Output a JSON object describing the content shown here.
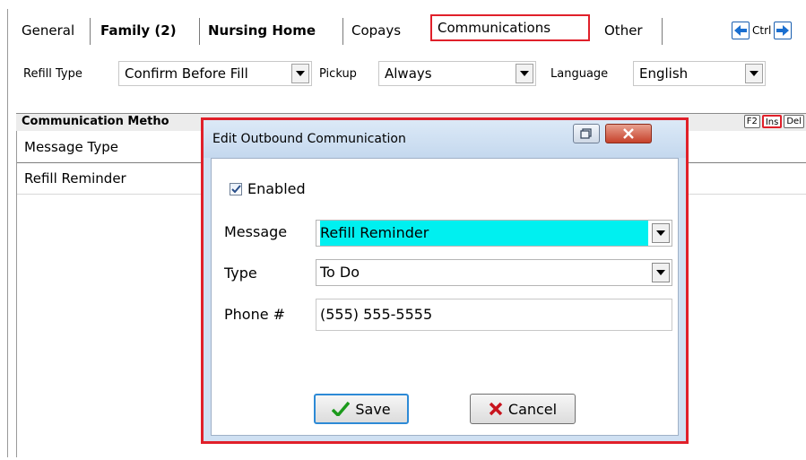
{
  "tabs": {
    "general": "General",
    "family": "Family (2)",
    "nursing_home": "Nursing Home",
    "copays": "Copays",
    "communications": "Communications",
    "other": "Other",
    "ctrl_label": "Ctrl"
  },
  "settings": {
    "refill_type_label": "Refill Type",
    "refill_type_value": "Confirm Before Fill",
    "pickup_label": "Pickup",
    "pickup_value": "Always",
    "language_label": "Language",
    "language_value": "English"
  },
  "comm_panel": {
    "title": "Communication Metho",
    "keys": [
      "F2",
      "Ins",
      "Del"
    ],
    "column_header": "Message Type",
    "rows": [
      "Refill Reminder"
    ]
  },
  "dialog": {
    "title": "Edit Outbound Communication",
    "enabled_label": "Enabled",
    "enabled_checked": true,
    "message_label": "Message",
    "message_value": "Refill Reminder",
    "type_label": "Type",
    "type_value": "To Do",
    "phone_label": "Phone #",
    "phone_value": "(555) 555-5555",
    "save_label": "Save",
    "cancel_label": "Cancel"
  },
  "colors": {
    "highlight_red": "#e0202a",
    "selection_cyan": "#00f0f0",
    "save_check_green": "#1c9a1c",
    "cancel_x_red": "#c8141e"
  }
}
